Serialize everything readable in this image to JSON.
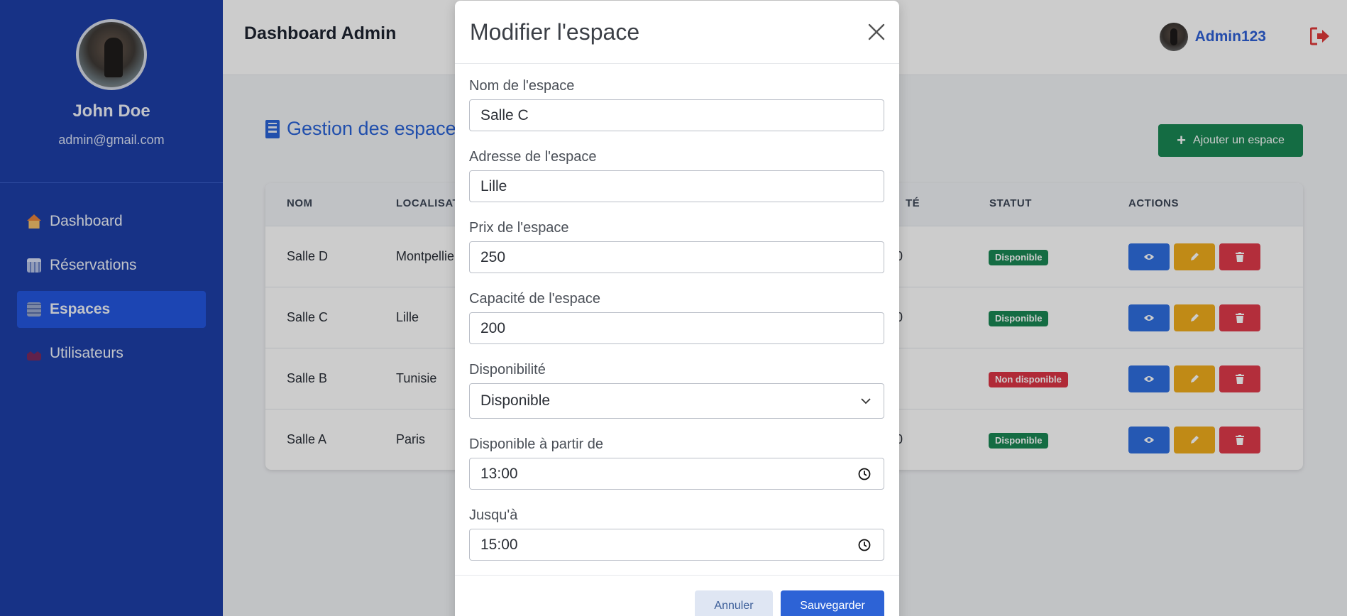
{
  "sidebar": {
    "profile": {
      "name": "John Doe",
      "email": "admin@gmail.com"
    },
    "items": [
      {
        "label": "Dashboard",
        "icon": "house-icon"
      },
      {
        "label": "Réservations",
        "icon": "calendar-icon"
      },
      {
        "label": "Espaces",
        "icon": "building-icon",
        "active": true
      },
      {
        "label": "Utilisateurs",
        "icon": "users-icon"
      }
    ]
  },
  "header": {
    "title": "Dashboard Admin",
    "username": "Admin123"
  },
  "main": {
    "section_title": "Gestion des espaces",
    "add_button": "Ajouter un espace",
    "table": {
      "headers": {
        "name": "NOM",
        "location": "LOCALISAT",
        "capacity": "TÉ",
        "status": "STATUT",
        "actions": "ACTIONS"
      },
      "rows": [
        {
          "name": "Salle D",
          "location": "Montpellier",
          "capacity": "0",
          "status": "Disponible"
        },
        {
          "name": "Salle C",
          "location": "Lille",
          "capacity": "0",
          "status": "Disponible"
        },
        {
          "name": "Salle B",
          "location": "Tunisie",
          "capacity": "",
          "status": "Non disponible"
        },
        {
          "name": "Salle A",
          "location": "Paris",
          "capacity": "0",
          "status": "Disponible"
        }
      ]
    }
  },
  "modal": {
    "title": "Modifier l'espace",
    "fields": {
      "name": {
        "label": "Nom de l'espace",
        "value": "Salle C"
      },
      "address": {
        "label": "Adresse de l'espace",
        "value": "Lille"
      },
      "price": {
        "label": "Prix de l'espace",
        "value": "250"
      },
      "capacity": {
        "label": "Capacité de l'espace",
        "value": "200"
      },
      "availability": {
        "label": "Disponibilité",
        "value": "Disponible"
      },
      "from": {
        "label": "Disponible à partir de",
        "value": "13:00"
      },
      "to": {
        "label": "Jusqu'à",
        "value": "15:00"
      }
    },
    "cancel": "Annuler",
    "save": "Sauvegarder"
  },
  "colors": {
    "sidebar": "#1d3fa8",
    "active": "#2457e0",
    "success": "#198754",
    "danger": "#dc3545",
    "warning": "#f0ad1c",
    "primary": "#2f6fe0"
  }
}
